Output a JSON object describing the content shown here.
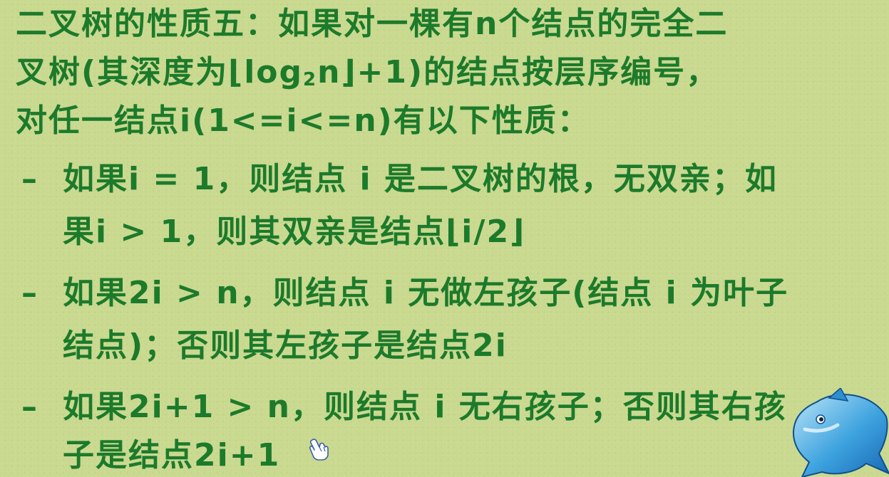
{
  "intro": {
    "line1": "二叉树的性质五：如果对一棵有n个结点的完全二",
    "line2_before": "叉树(其深度为⌊log",
    "line2_sub": "2",
    "line2_after": "n⌋+1)的结点按层序编号，",
    "line3": "对任一结点i(1<=i<=n)有以下性质："
  },
  "bullets": [
    {
      "marker": "–",
      "line1": "如果i = 1，则结点 i 是二叉树的根，无双亲；如",
      "line2": "果i > 1，则其双亲是结点⌊i/2⌋"
    },
    {
      "marker": "–",
      "line1": "如果2i > n，则结点 i 无做左孩子(结点 i 为叶子",
      "line2": "结点)；否则其左孩子是结点2i"
    },
    {
      "marker": "–",
      "line1": "如果2i+1 > n，则结点 i 无右孩子；否则其右孩",
      "line2": "子是结点2i+1"
    }
  ],
  "icons": {
    "cursor": "hand-cursor-icon",
    "mascot": "dolphin-icon"
  },
  "colors": {
    "background": "#c9d98f",
    "text": "#1c7a2b"
  }
}
